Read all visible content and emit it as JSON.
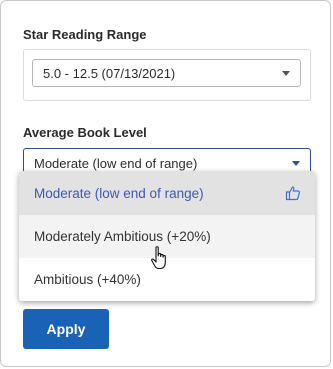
{
  "star_reading": {
    "title": "Star Reading Range",
    "selected": "5.0 - 12.5 (07/13/2021)"
  },
  "book_level": {
    "title": "Average Book Level",
    "selected": "Moderate (low end of range)",
    "options": [
      {
        "label": "Moderate (low end of range)",
        "icon": "thumbs-up-icon"
      },
      {
        "label": "Moderately Ambitious (+20%)"
      },
      {
        "label": "Ambitious (+40%)"
      }
    ]
  },
  "apply_label": "Apply",
  "colors": {
    "accent": "#3f57b4",
    "button": "#1a62b5"
  }
}
